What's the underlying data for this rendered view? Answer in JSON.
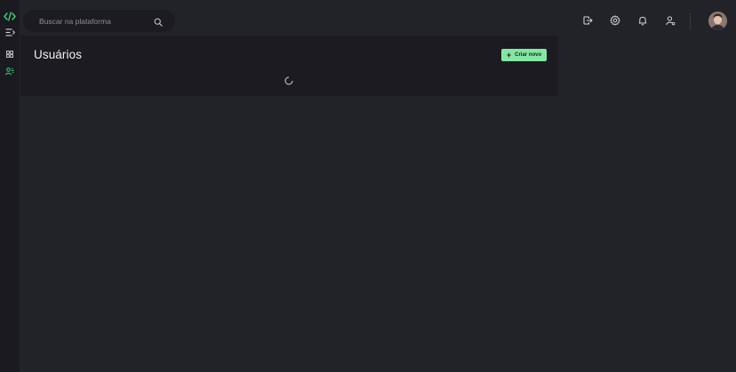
{
  "app": {
    "logo_icon": "code-brackets-icon",
    "accent_color": "#3fd37a"
  },
  "sidebar": {
    "items": [
      {
        "icon": "menu-collapse-icon"
      },
      {
        "icon": "dashboard-grid-icon"
      },
      {
        "icon": "users-icon",
        "active": true
      }
    ]
  },
  "search": {
    "placeholder": "Buscar na plataforma",
    "value": "",
    "icon": "search-icon"
  },
  "header": {
    "actions": [
      {
        "icon": "logout-icon"
      },
      {
        "icon": "gear-icon"
      },
      {
        "icon": "bell-icon"
      },
      {
        "icon": "user-settings-icon"
      }
    ],
    "avatar": "user-avatar"
  },
  "main": {
    "title": "Usuários",
    "create_button": {
      "icon": "plus-icon",
      "label": "Criar novo",
      "color": "#84e6a4"
    },
    "loading": true
  }
}
